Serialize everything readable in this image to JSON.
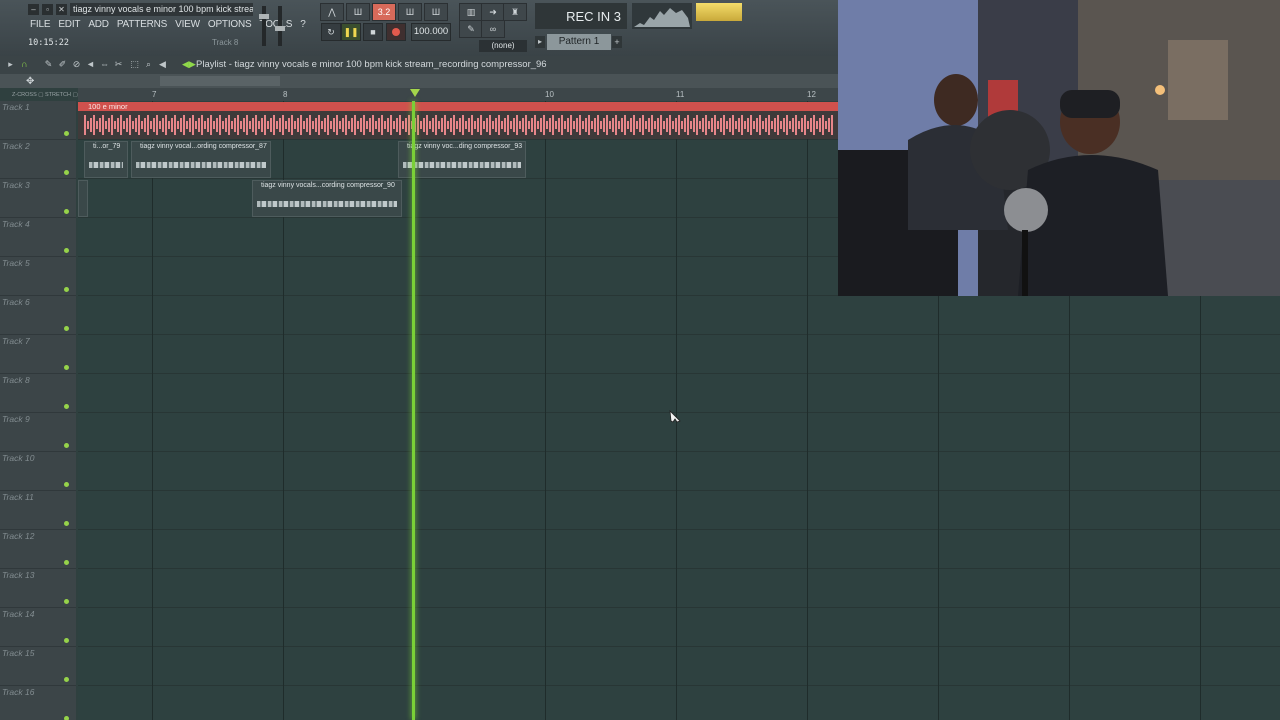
{
  "window": {
    "title": "tiagz vinny vocals e minor 100 bpm kick stream",
    "time": "10:15:22",
    "hint": "Track 8"
  },
  "menu": [
    "FILE",
    "EDIT",
    "ADD",
    "PATTERNS",
    "VIEW",
    "OPTIONS",
    "TOOLS",
    "?"
  ],
  "transport": {
    "tempo": "100.000",
    "rec_in": "REC IN 3",
    "pattern": "Pattern 1",
    "none_selector": "(none)",
    "mode_label": "3.2"
  },
  "playlist": {
    "title": "Playlist - tiagz vinny vocals e minor 100 bpm kick stream_recording compressor_96",
    "ruler": [
      "7",
      "8",
      "9",
      "10",
      "11",
      "12"
    ],
    "tracks": [
      "Track 1",
      "Track 2",
      "Track 3",
      "Track 4",
      "Track 5",
      "Track 6",
      "Track 7",
      "Track 8",
      "Track 9",
      "Track 10",
      "Track 11",
      "Track 12",
      "Track 13",
      "Track 14",
      "Track 15",
      "Track 16"
    ],
    "clips": {
      "track1": "100 e minor",
      "track2_a": "ti...or_79",
      "track2_b": "tiagz vinny vocal...ording compressor_87",
      "track2_c": "tiagz vinny voc...ding compressor_93",
      "track3_a": "tiagz vinny vocals...cording compressor_90"
    }
  },
  "colors": {
    "accent_green": "#7ad037",
    "clip_red": "#d0514d",
    "record_red": "#e35a4d"
  }
}
